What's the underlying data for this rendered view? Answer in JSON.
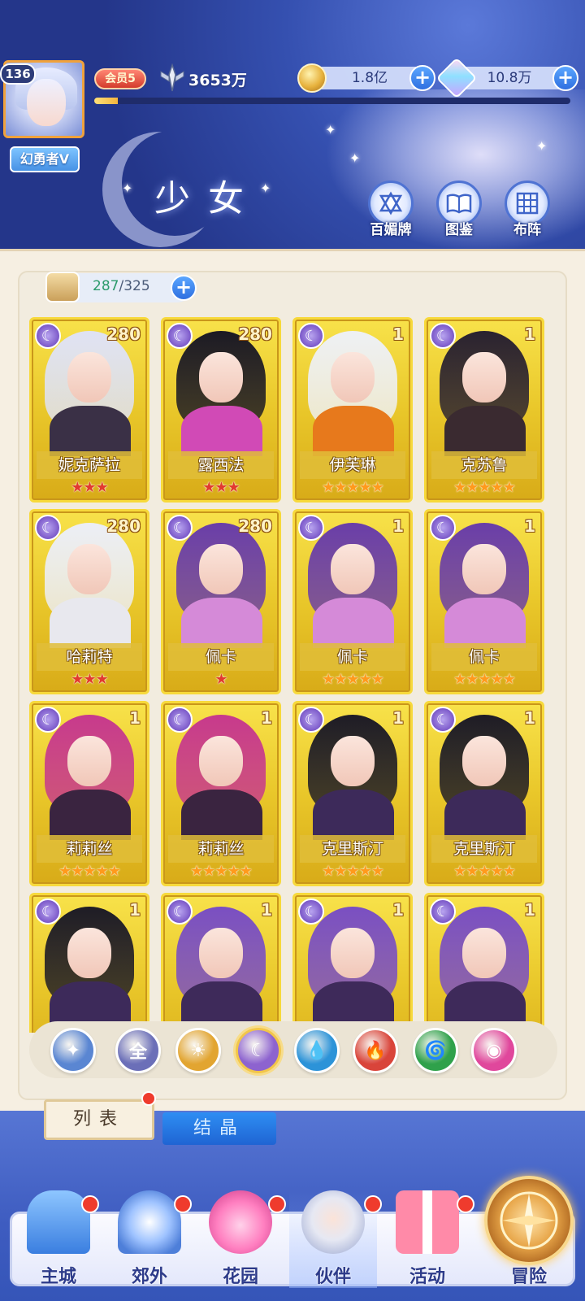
{
  "player": {
    "level": "136",
    "title": "幻勇者V",
    "vip": "会员5",
    "power": "3653万",
    "exp_progress": 0.05
  },
  "currency": {
    "gold": "1.8亿",
    "gems": "10.8万"
  },
  "header": {
    "section_title": "少女",
    "buttons": [
      {
        "label": "百媚牌",
        "icon": "card-deck-icon"
      },
      {
        "label": "图鉴",
        "icon": "book-icon"
      },
      {
        "label": "布阵",
        "icon": "formation-grid-icon"
      }
    ]
  },
  "roster": {
    "count_current": "287",
    "count_sep": "/",
    "count_max": "325"
  },
  "cards": [
    {
      "name": "妮克萨拉",
      "level": "280",
      "stars": 3,
      "star_color": "red",
      "hair": "#dfe2f4",
      "body": "#3a3046"
    },
    {
      "name": "露西法",
      "level": "280",
      "stars": 3,
      "star_color": "red",
      "hair": "#1c1a24",
      "body": "#d14ab6"
    },
    {
      "name": "伊芙琳",
      "level": "1",
      "stars": 5,
      "star_color": "gold",
      "hair": "#eef0f4",
      "body": "#e7791c"
    },
    {
      "name": "克苏鲁",
      "level": "1",
      "stars": 5,
      "star_color": "gold",
      "hair": "#2a2230",
      "body": "#3a2a30"
    },
    {
      "name": "哈莉特",
      "level": "280",
      "stars": 3,
      "star_color": "red",
      "hair": "#eceef6",
      "body": "#e8e8ee"
    },
    {
      "name": "佩卡",
      "level": "280",
      "stars": 1,
      "star_color": "red",
      "hair": "#6a3ea8",
      "body": "#d58ad8"
    },
    {
      "name": "佩卡",
      "level": "1",
      "stars": 5,
      "star_color": "gold",
      "hair": "#6a3ea8",
      "body": "#d58ad8"
    },
    {
      "name": "佩卡",
      "level": "1",
      "stars": 5,
      "star_color": "gold",
      "hair": "#6a3ea8",
      "body": "#d58ad8"
    },
    {
      "name": "莉莉丝",
      "level": "1",
      "stars": 5,
      "star_color": "gold",
      "hair": "#c73a8c",
      "body": "#3a2440"
    },
    {
      "name": "莉莉丝",
      "level": "1",
      "stars": 5,
      "star_color": "gold",
      "hair": "#c73a8c",
      "body": "#3a2440"
    },
    {
      "name": "克里斯汀",
      "level": "1",
      "stars": 5,
      "star_color": "gold",
      "hair": "#1e1c26",
      "body": "#3d2a5a"
    },
    {
      "name": "克里斯汀",
      "level": "1",
      "stars": 5,
      "star_color": "gold",
      "hair": "#1e1c26",
      "body": "#3d2a5a"
    },
    {
      "name": "",
      "level": "1",
      "stars": 0,
      "star_color": "gold",
      "hair": "#1e1c26",
      "body": "#3d2a5a"
    },
    {
      "name": "",
      "level": "1",
      "stars": 0,
      "star_color": "gold",
      "hair": "#7a4fc2",
      "body": "#3e2a5a"
    },
    {
      "name": "",
      "level": "1",
      "stars": 0,
      "star_color": "gold",
      "hair": "#7a4fc2",
      "body": "#3e2a5a"
    },
    {
      "name": "",
      "level": "1",
      "stars": 0,
      "star_color": "gold",
      "hair": "#7a4fc2",
      "body": "#3e2a5a"
    }
  ],
  "filters": [
    {
      "name": "filter-sky",
      "icon": "wing-icon",
      "glyph": "✦",
      "color": "#5a86d2"
    },
    {
      "name": "filter-all",
      "icon": "all-icon",
      "glyph": "全",
      "color": "#6b6fb8"
    },
    {
      "name": "filter-sun",
      "icon": "sun-icon",
      "glyph": "☀",
      "color": "#e2a531"
    },
    {
      "name": "filter-moon",
      "icon": "moon-icon",
      "glyph": "☾",
      "color": "#8d63cf",
      "selected": true
    },
    {
      "name": "filter-water",
      "icon": "water-icon",
      "glyph": "💧",
      "color": "#2c93d8"
    },
    {
      "name": "filter-fire",
      "icon": "fire-icon",
      "glyph": "🔥",
      "color": "#d9443a"
    },
    {
      "name": "filter-wind",
      "icon": "wind-icon",
      "glyph": "🌀",
      "color": "#2fa14b"
    },
    {
      "name": "filter-heart",
      "icon": "heart-icon",
      "glyph": "◉",
      "color": "#e0479c"
    }
  ],
  "tabs": {
    "list": "列表",
    "crystal": "结晶"
  },
  "nav": {
    "items": [
      {
        "label": "主城",
        "icon": "castle-icon"
      },
      {
        "label": "郊外",
        "icon": "portal-icon"
      },
      {
        "label": "花园",
        "icon": "heart-garden-icon"
      },
      {
        "label": "伙伴",
        "icon": "partner-icon"
      },
      {
        "label": "活动",
        "icon": "gift-icon"
      }
    ],
    "adventure": "冒险"
  }
}
